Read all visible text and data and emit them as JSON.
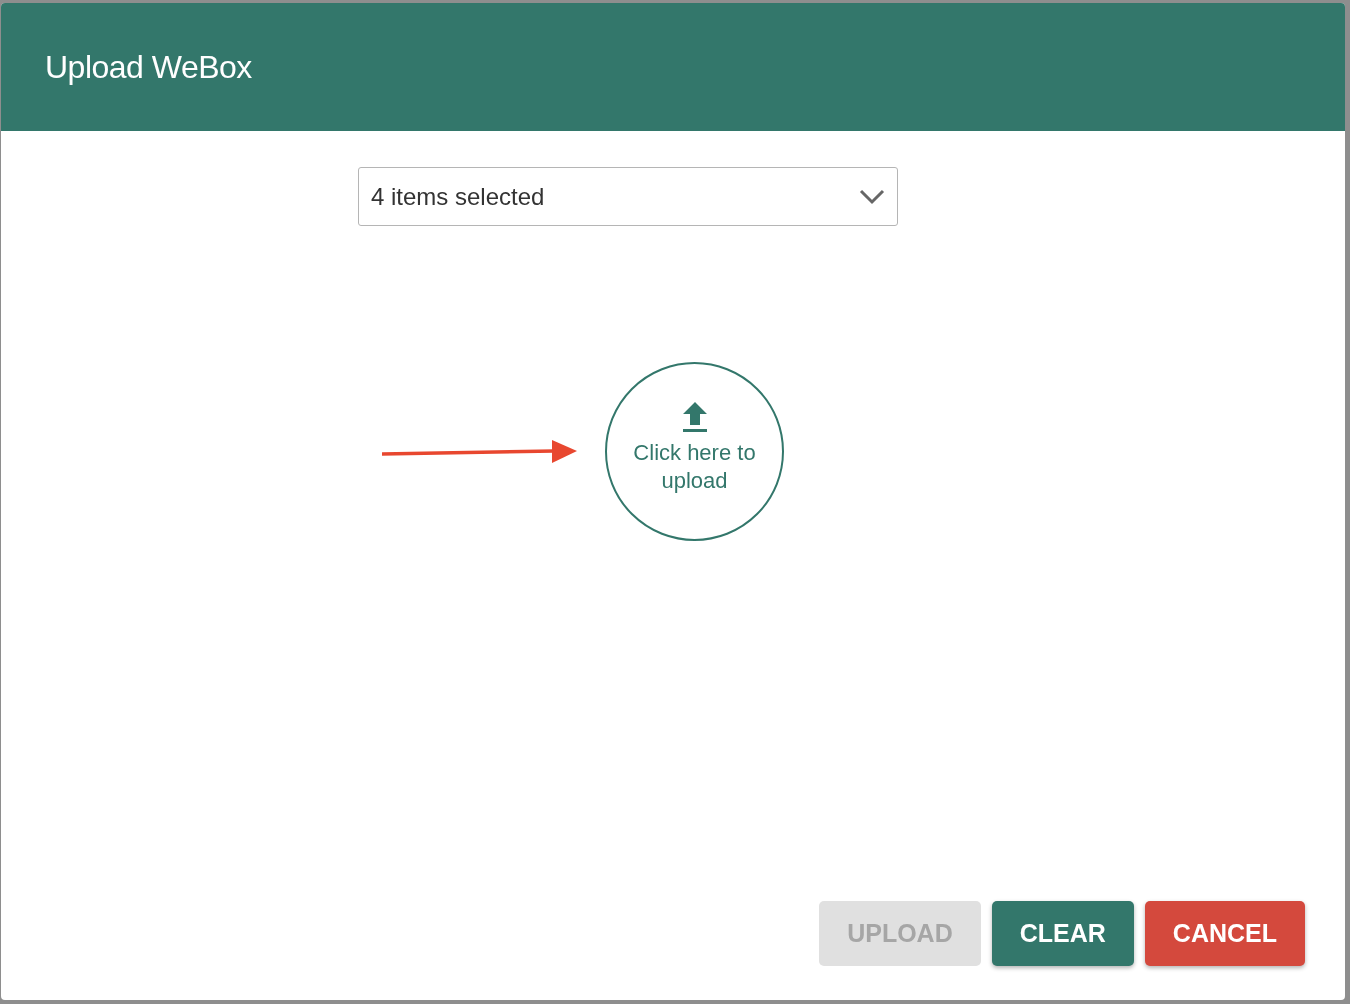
{
  "dialog": {
    "title": "Upload WeBox"
  },
  "dropdown": {
    "value": "4 items selected"
  },
  "upload_area": {
    "label": "Click here to upload"
  },
  "buttons": [
    {
      "label": "UPLOAD",
      "kind": "primary",
      "disabled": true
    },
    {
      "label": "CLEAR",
      "kind": "secondary",
      "disabled": false
    },
    {
      "label": "CANCEL",
      "kind": "danger",
      "disabled": false
    }
  ]
}
